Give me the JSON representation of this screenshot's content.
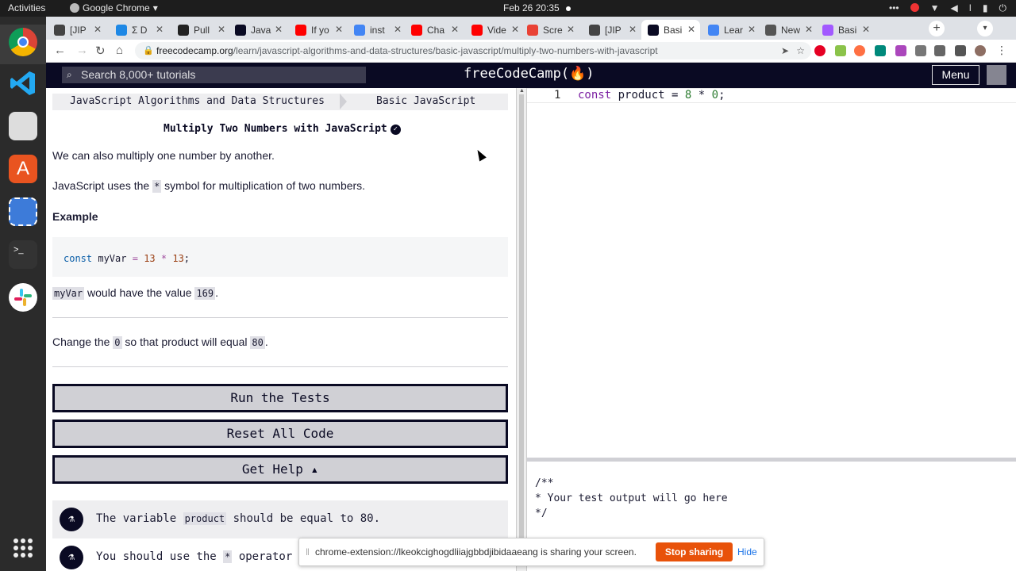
{
  "system": {
    "activities": "Activities",
    "app_name": "Google Chrome",
    "clock": "Feb 26  20:35"
  },
  "browser": {
    "tabs": [
      {
        "label": "[JIP",
        "color": "#444"
      },
      {
        "label": "Σ D",
        "color": "#1e88e5"
      },
      {
        "label": "Pull",
        "color": "#222"
      },
      {
        "label": "Java",
        "color": "#0a0a23"
      },
      {
        "label": "If yo",
        "color": "#ff0000"
      },
      {
        "label": "inst",
        "color": "#4285f4"
      },
      {
        "label": "Cha",
        "color": "#ff0000"
      },
      {
        "label": "Vide",
        "color": "#ff0000"
      },
      {
        "label": "Scre",
        "color": "#e94235"
      },
      {
        "label": "[JIP",
        "color": "#444"
      },
      {
        "label": "Basi",
        "color": "#0a0a23"
      },
      {
        "label": "Lear",
        "color": "#4285f4"
      },
      {
        "label": "New",
        "color": "#555"
      },
      {
        "label": "Basi",
        "color": "#a259ff"
      }
    ],
    "active_tab_index": 10,
    "url_host": "freecodecamp.org",
    "url_path": "/learn/javascript-algorithms-and-data-structures/basic-javascript/multiply-two-numbers-with-javascript"
  },
  "fcc_nav": {
    "search_placeholder": "Search 8,000+ tutorials",
    "logo": "freeCodeCamp(🔥)",
    "menu": "Menu"
  },
  "breadcrumb": {
    "course": "JavaScript Algorithms and Data Structures",
    "section": "Basic JavaScript"
  },
  "challenge": {
    "title": "Multiply Two Numbers with JavaScript",
    "p1": "We can also multiply one number by another.",
    "p2_a": "JavaScript uses the ",
    "p2_code": "*",
    "p2_b": " symbol for multiplication of two numbers.",
    "example_heading": "Example",
    "example_code": {
      "kw": "const",
      "name": "myVar",
      "eq": "=",
      "n1": "13",
      "op": "*",
      "n2": "13",
      "end": ";"
    },
    "p3_code1": "myVar",
    "p3_mid": " would have the value ",
    "p3_code2": "169",
    "p3_end": ".",
    "task_a": "Change the ",
    "task_code1": "0",
    "task_b": " so that product will equal ",
    "task_code2": "80",
    "task_end": "."
  },
  "buttons": {
    "run_tests": "Run the Tests",
    "reset": "Reset All Code",
    "help": "Get Help ▴"
  },
  "tests": [
    {
      "a": "The variable ",
      "code": "product",
      "b": " should be equal to 80."
    },
    {
      "a": "You should use the ",
      "code": "*",
      "b": " operator"
    }
  ],
  "editor": {
    "line_number": "1",
    "code": {
      "kw": "const",
      "name": "product",
      "eq": "=",
      "n1": "8",
      "op": "*",
      "n2": "0",
      "end": ";"
    }
  },
  "console_text": "/**\n* Your test output will go here\n*/",
  "share_bar": {
    "message": "chrome-extension://lkeokcighogdliiajgbbdjibidaaeang is sharing your screen.",
    "stop": "Stop sharing",
    "hide": "Hide"
  }
}
